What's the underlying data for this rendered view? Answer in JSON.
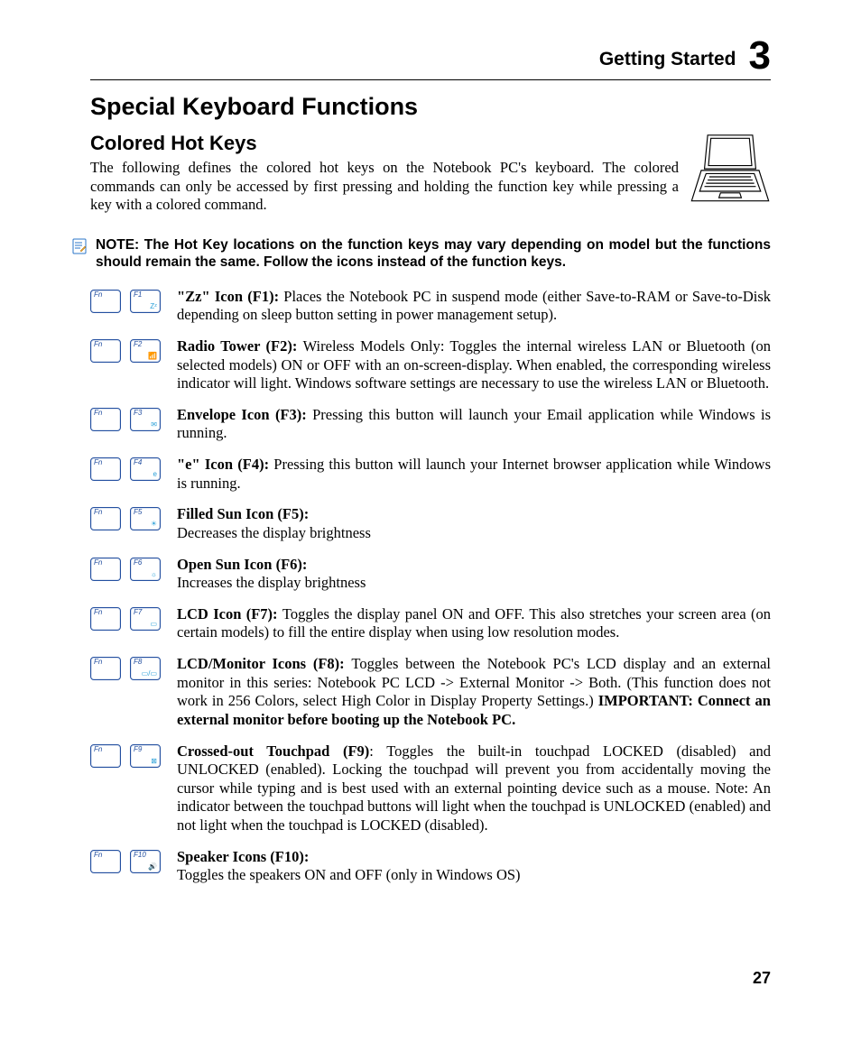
{
  "header": {
    "section": "Getting Started",
    "chapter": "3"
  },
  "title": "Special Keyboard Functions",
  "sub": {
    "heading": "Colored Hot Keys",
    "para": "The following defines the colored hot keys on the Notebook PC's keyboard. The colored commands can only be accessed by first pressing and holding the function key while pressing a key with a colored command."
  },
  "note": "NOTE: The Hot Key locations on the function keys may vary depending on model but the functions should remain the same. Follow the icons instead of the function keys.",
  "fn": "Fn",
  "items": [
    {
      "key": "F1",
      "sym": "Zᶻ",
      "bold": "\"Zz\" Icon (F1): ",
      "text": "Places the Notebook PC in suspend mode (either Save-to-RAM or Save-to-Disk depending on sleep button setting in power management setup)."
    },
    {
      "key": "F2",
      "sym": "📶",
      "bold": "Radio Tower (F2): ",
      "text": "Wireless Models Only: Toggles the internal wireless LAN or Bluetooth (on selected models) ON or OFF with an on-screen-display. When enabled, the corresponding wireless indicator will light. Windows software settings are necessary to use the wireless LAN or Bluetooth."
    },
    {
      "key": "F3",
      "sym": "✉",
      "bold": "Envelope Icon (F3): ",
      "text": "Pressing this button will launch your Email application while Windows is running."
    },
    {
      "key": "F4",
      "sym": "e",
      "bold": "\"e\" Icon (F4): ",
      "text": "Pressing this button will launch your Internet browser application while Windows is running."
    },
    {
      "key": "F5",
      "sym": "☀",
      "bold": "Filled Sun Icon (F5):",
      "text": "Decreases the display brightness",
      "break": true
    },
    {
      "key": "F6",
      "sym": "☼",
      "bold": "Open Sun Icon (F6):",
      "text": "Increases the display brightness",
      "break": true
    },
    {
      "key": "F7",
      "sym": "▭",
      "bold": "LCD Icon (F7): ",
      "text": "Toggles the display panel ON and OFF. This also stretches your screen area (on certain models) to fill the entire display when using low resolution modes."
    },
    {
      "key": "F8",
      "sym": "▭/▭",
      "bold": "LCD/Monitor Icons (F8): ",
      "text": "Toggles between the Notebook PC's LCD display and an external monitor in this series: Notebook PC LCD -> External Monitor -> Both. (This function does not work in 256 Colors, select High Color in Display Property Settings.) ",
      "tail_bold": "IMPORTANT: Connect an external monitor before booting up the Notebook PC."
    },
    {
      "key": "F9",
      "sym": "⊠",
      "bold": "Crossed-out Touchpad (F9)",
      "text": ": Toggles the built-in touchpad LOCKED (disabled) and UNLOCKED (enabled). Locking the touchpad will prevent you from accidentally moving the cursor while typing and is best used with an external pointing device such as a mouse. Note: An indicator between the touchpad buttons will light when the touchpad is UNLOCKED (enabled) and not light when the touchpad is LOCKED (disabled)."
    },
    {
      "key": "F10",
      "sym": "🔊",
      "bold": "Speaker Icons (F10):",
      "text": "Toggles the speakers ON and OFF (only in Windows OS)",
      "break": true
    }
  ],
  "page_number": "27"
}
